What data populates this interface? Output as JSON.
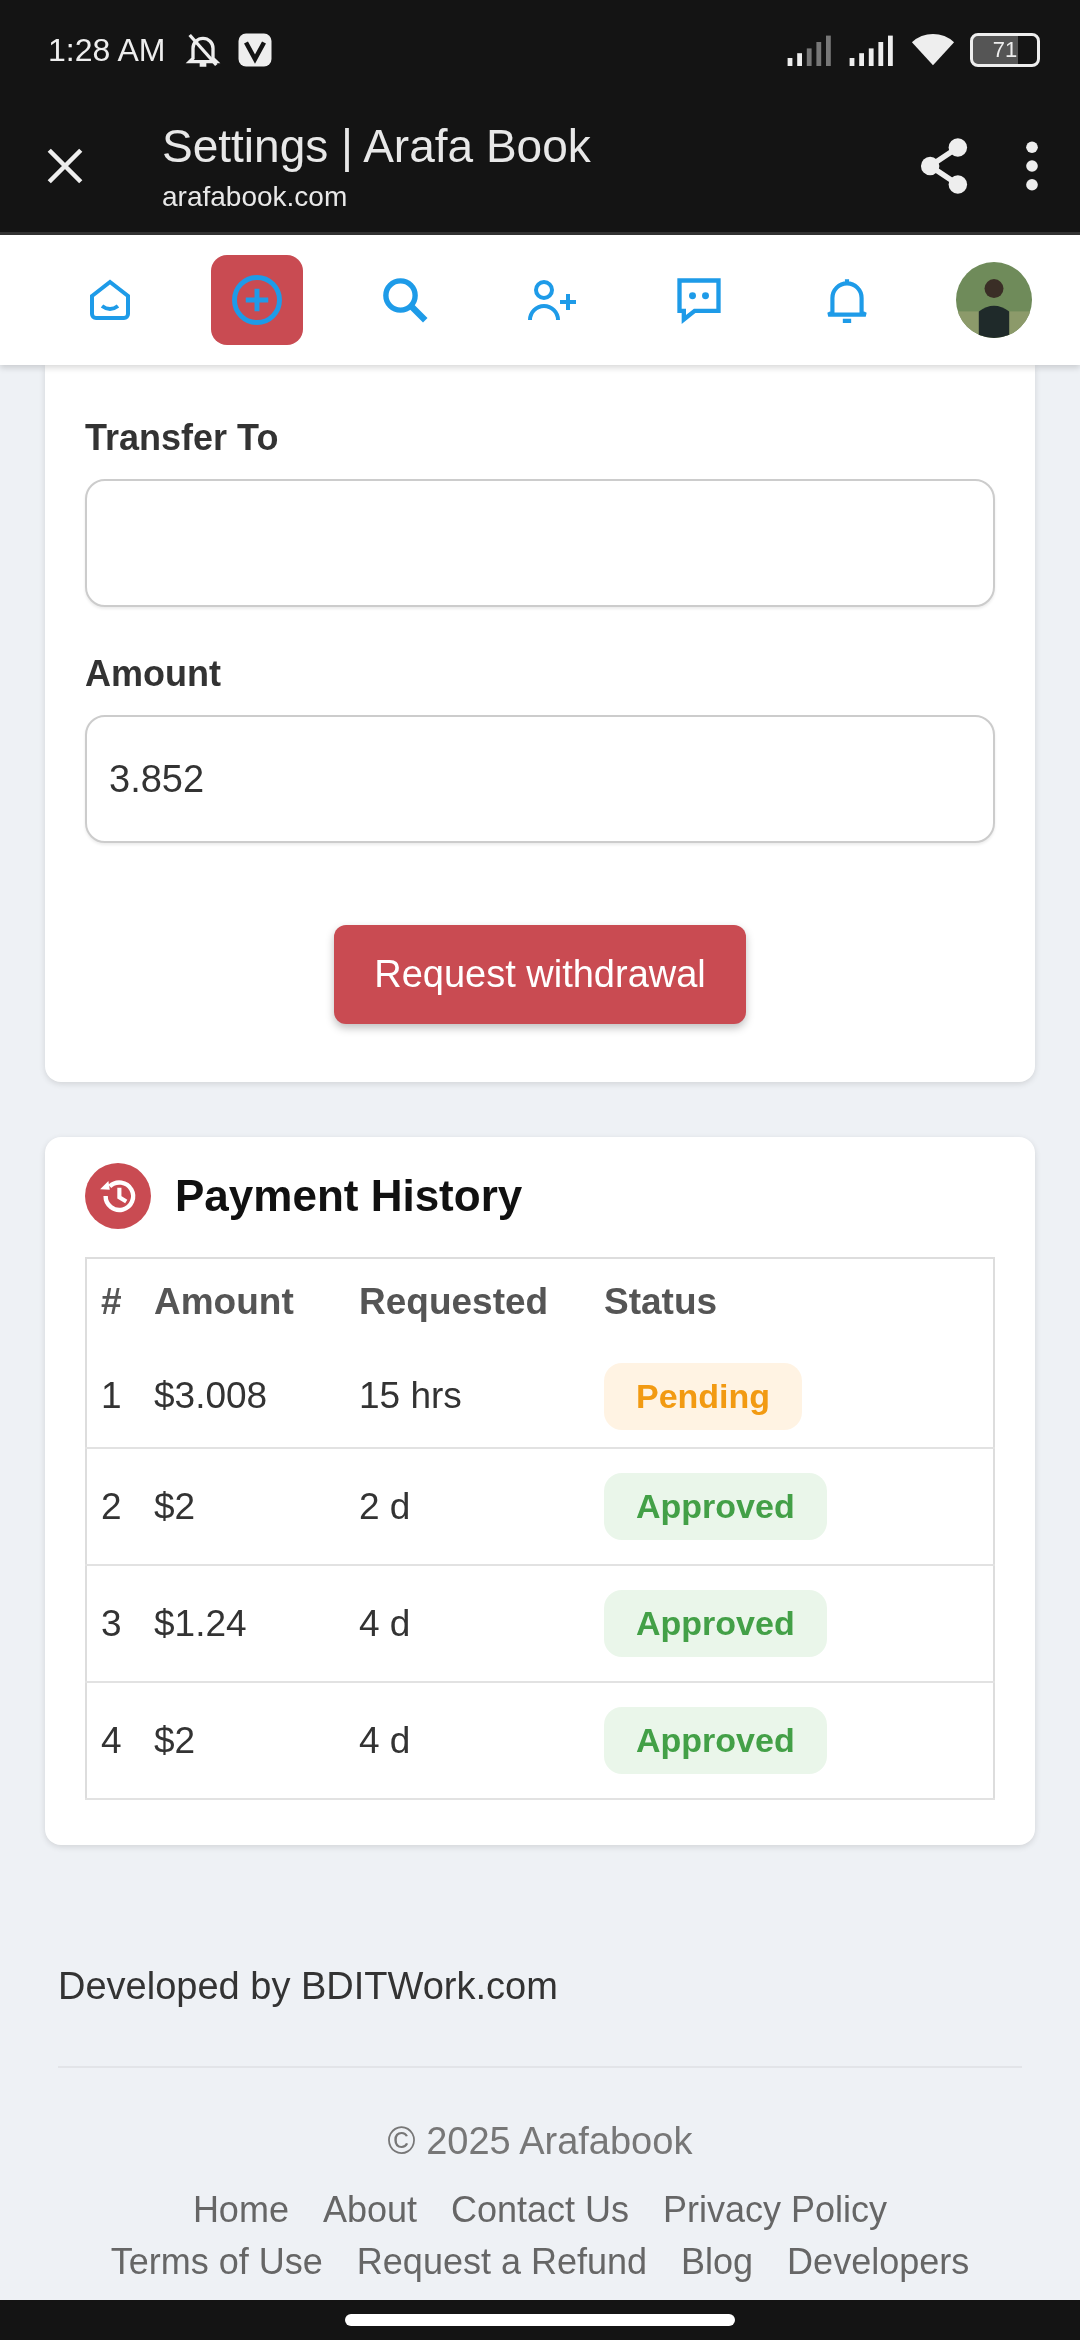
{
  "status_bar": {
    "time": "1:28 AM",
    "battery": "71"
  },
  "browser_bar": {
    "title": "Settings | Arafa Book",
    "url": "arafabook.com"
  },
  "nav": [
    {
      "kind": "home",
      "selected": false
    },
    {
      "kind": "add",
      "selected": true
    },
    {
      "kind": "search",
      "selected": false
    },
    {
      "kind": "friend",
      "selected": false
    },
    {
      "kind": "chat",
      "selected": false
    },
    {
      "kind": "bell",
      "selected": false
    },
    {
      "kind": "profile",
      "selected": false
    }
  ],
  "withdraw_form": {
    "fields": [
      {
        "label": "Transfer To"
      },
      {
        "label": "Amount",
        "value": "3.852"
      }
    ],
    "button": "Request withdrawal"
  },
  "payment_history": {
    "title": "Payment History",
    "columns": [
      "#",
      "Amount",
      "Requested",
      "Status"
    ],
    "rows": [
      {
        "index": "1",
        "amount": "$3.008",
        "requested": "15 hrs",
        "status": "Pending",
        "kind": "pending"
      },
      {
        "index": "2",
        "amount": "$2",
        "requested": "2 d",
        "status": "Approved",
        "kind": "approved"
      },
      {
        "index": "3",
        "amount": "$1.24",
        "requested": "4 d",
        "status": "Approved",
        "kind": "approved"
      },
      {
        "index": "4",
        "amount": "$2",
        "requested": "4 d",
        "status": "Approved",
        "kind": "approved"
      }
    ]
  },
  "footer": {
    "credit": "Developed by BDITWork.com",
    "copyright": "© 2025 Arafabook",
    "links": [
      [
        "Home",
        "About",
        "Contact Us",
        "Privacy Policy"
      ],
      [
        "Terms of Use",
        "Request a Refund",
        "Blog",
        "Developers"
      ]
    ]
  }
}
